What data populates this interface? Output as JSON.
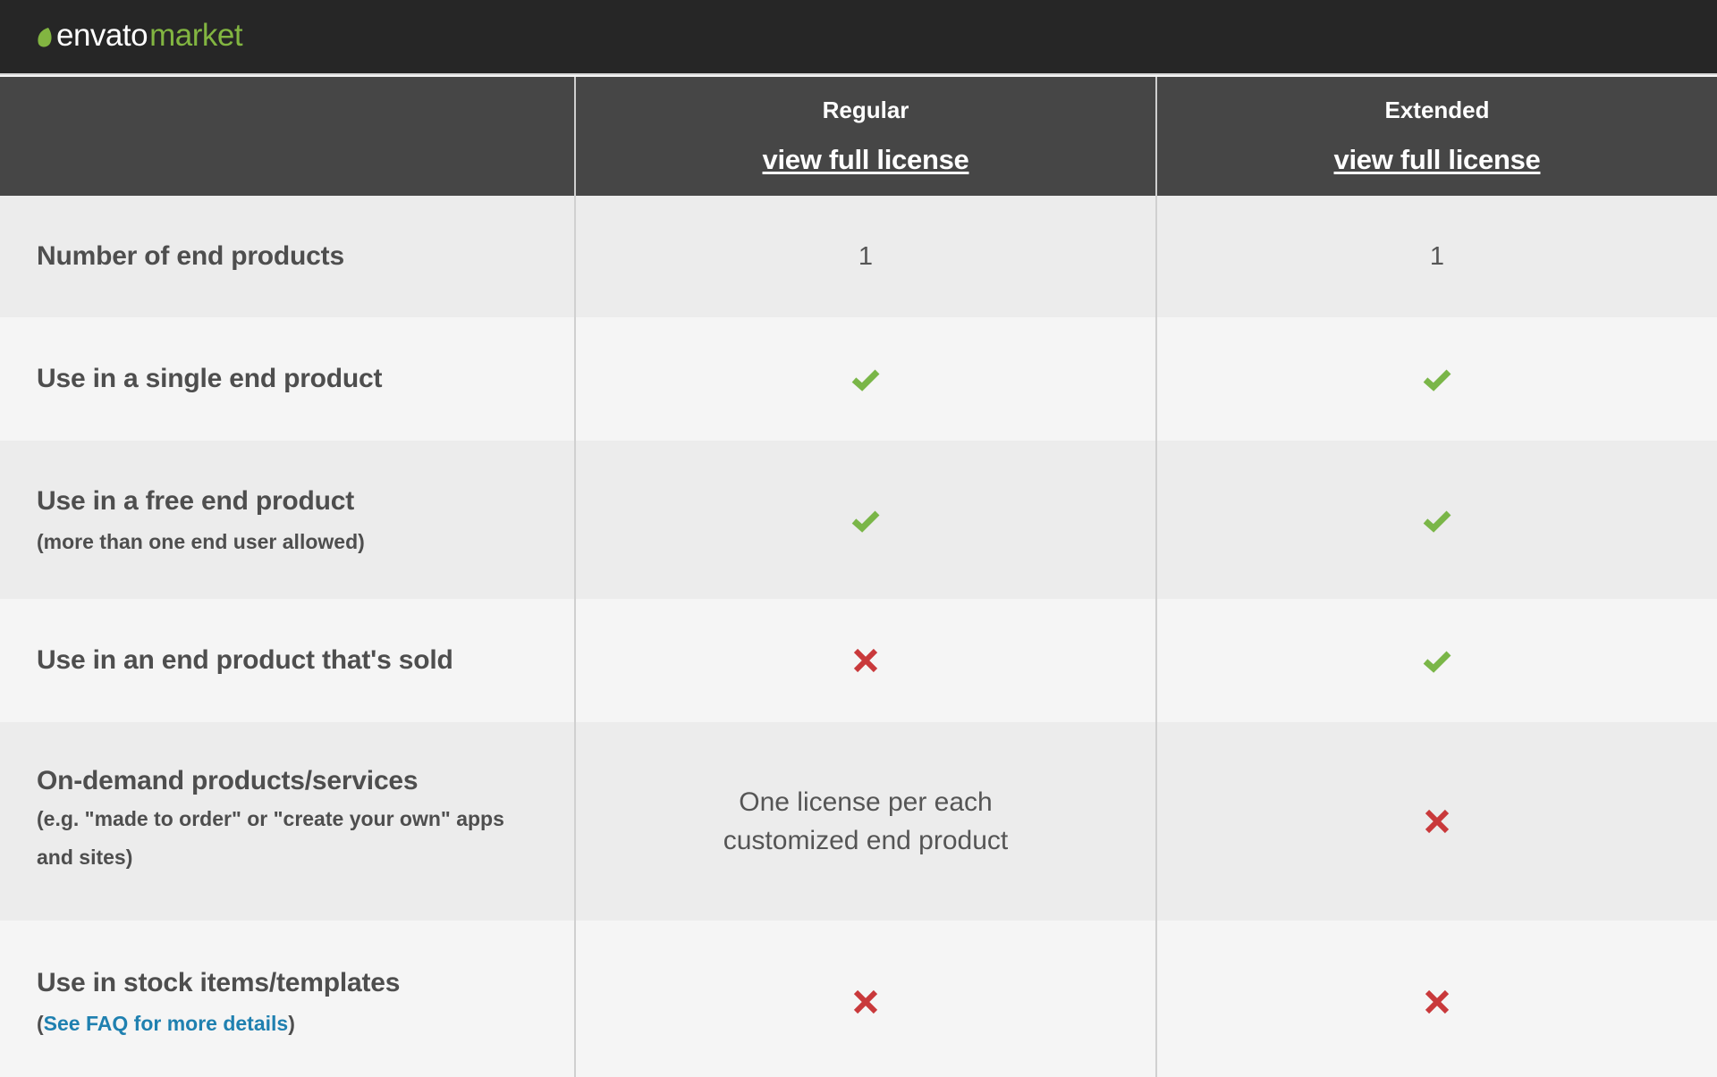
{
  "header": {
    "brand": "envato",
    "brand_suffix": "market",
    "colors": {
      "background": "#262626",
      "brand_green": "#82b541"
    }
  },
  "table": {
    "columns": [
      {
        "plan": "Regular",
        "link": "view full license"
      },
      {
        "plan": "Extended",
        "link": "view full license"
      }
    ],
    "rows": [
      {
        "label": "Number of end products",
        "sub": "",
        "regular": {
          "type": "text",
          "value": "1"
        },
        "extended": {
          "type": "text",
          "value": "1"
        }
      },
      {
        "label": "Use in a single end product",
        "sub": "",
        "regular": {
          "type": "check"
        },
        "extended": {
          "type": "check"
        }
      },
      {
        "label": "Use in a free end product",
        "sub": "(more than one end user allowed)",
        "regular": {
          "type": "check"
        },
        "extended": {
          "type": "check"
        }
      },
      {
        "label": "Use in an end product that's sold",
        "sub": "",
        "regular": {
          "type": "cross"
        },
        "extended": {
          "type": "check"
        }
      },
      {
        "label": "On-demand products/services",
        "sub": "(e.g. \"made to order\" or \"create your own\" apps and sites)",
        "regular": {
          "type": "text",
          "value": "One license per each customized end product"
        },
        "extended": {
          "type": "cross"
        }
      },
      {
        "label": "Use in stock items/templates",
        "sub_prefix": "(",
        "sub_link": "See FAQ for more details",
        "sub_suffix": ")",
        "regular": {
          "type": "cross"
        },
        "extended": {
          "type": "cross"
        }
      }
    ]
  },
  "icons": {
    "check": "check-icon",
    "cross": "cross-icon"
  },
  "colors": {
    "check": "#7ab648",
    "cross": "#c9393b",
    "link": "#1f80b0",
    "header_row": "#464646"
  }
}
